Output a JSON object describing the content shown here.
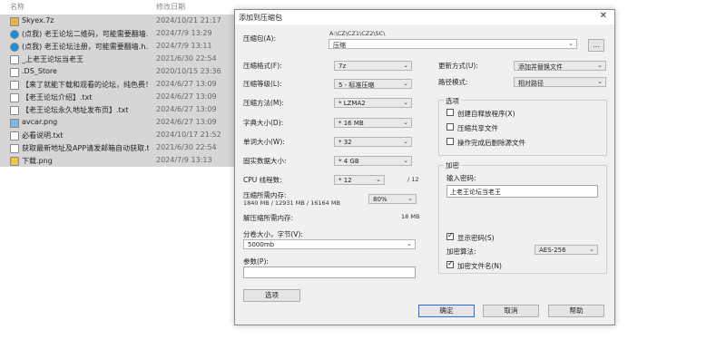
{
  "explorer": {
    "header": {
      "name": "名称",
      "date": "修改日期"
    },
    "files": [
      {
        "name": "Skyex.7z",
        "date": "2024/10/21 21:17",
        "icon": "folder-zip-icon",
        "color": "#e8b54a"
      },
      {
        "name": "(点我) 老王论坛二维码，可能需要翻墙...",
        "date": "2024/7/9 13:29",
        "icon": "edge-icon",
        "color": "#1f8cd6"
      },
      {
        "name": "(点我) 老王论坛注册，可能需要翻墙.h...",
        "date": "2024/7/9 13:11",
        "icon": "edge-icon",
        "color": "#1f8cd6"
      },
      {
        "name": "_上老王论坛当老王",
        "date": "2021/6/30 22:54",
        "icon": "file-icon",
        "color": "#ffffff"
      },
      {
        "name": ".DS_Store",
        "date": "2020/10/15 23:36",
        "icon": "file-icon",
        "color": "#ffffff"
      },
      {
        "name": "【来了就能下载和观看的论坛，纯色费！...",
        "date": "2024/6/27 13:09",
        "icon": "text-file-icon",
        "color": "#ffffff"
      },
      {
        "name": "【老王论坛介绍】.txt",
        "date": "2024/6/27 13:09",
        "icon": "text-file-icon",
        "color": "#ffffff"
      },
      {
        "name": "【老王论坛永久地址发布页】.txt",
        "date": "2024/6/27 13:09",
        "icon": "text-file-icon",
        "color": "#ffffff"
      },
      {
        "name": "avcar.png",
        "date": "2024/6/27 13:09",
        "icon": "image-icon",
        "color": "#8ab4e0"
      },
      {
        "name": "必看说明.txt",
        "date": "2024/10/17 21:52",
        "icon": "text-file-icon",
        "color": "#ffffff"
      },
      {
        "name": "获取最新地址及APP请发邮箱自动获取.txt",
        "date": "2021/6/30 22:54",
        "icon": "text-file-icon",
        "color": "#ffffff"
      },
      {
        "name": "下载.png",
        "date": "2024/7/9 13:13",
        "icon": "image-icon",
        "color": "#e8c84a"
      }
    ]
  },
  "dialog": {
    "title": "添加到压缩包",
    "close": "✕",
    "archive_label": "压缩包(A):",
    "archive_path": "A:\\CZ\\CZ1\\CZ2\\SC\\",
    "archive_name": "压缩",
    "browse": "...",
    "format_label": "压缩格式(F):",
    "format_value": "7z",
    "level_label": "压缩等级(L):",
    "level_value": "5 - 标准压缩",
    "method_label": "压缩方法(M):",
    "method_value": "* LZMA2",
    "dict_label": "字典大小(D):",
    "dict_value": "* 16 MB",
    "word_label": "单词大小(W):",
    "word_value": "* 32",
    "solid_label": "固实数据大小:",
    "solid_value": "* 4 GB",
    "threads_label": "CPU 线程数:",
    "threads_value": "* 12",
    "threads_max": "/ 12",
    "mem_label": "压缩所需内存:",
    "mem_values": "1840 MB / 12931 MB / 16164 MB",
    "mem_percent": "80%",
    "decomp_label": "解压缩所需内存:",
    "decomp_value": "18 MB",
    "split_label": "分卷大小，字节(V):",
    "split_value": "5000mb",
    "params_label": "参数(P):",
    "params_value": "",
    "options_button": "选项",
    "update_label": "更新方式(U):",
    "update_value": "添加并替换文件",
    "pathmode_label": "路径模式:",
    "pathmode_value": "相对路径",
    "options_group": "选项",
    "opt_sfx": "创建自释放程序(X)",
    "opt_shared": "压缩共享文件",
    "opt_delete": "操作完成后删除源文件",
    "enc_group": "加密",
    "pwd_label": "输入密码:",
    "pwd_value": "上老王论坛当老王",
    "show_pwd": "显示密码(S)",
    "enc_method_label": "加密算法:",
    "enc_method_value": "AES-256",
    "enc_names": "加密文件名(N)",
    "ok": "确定",
    "cancel": "取消",
    "help": "帮助"
  }
}
